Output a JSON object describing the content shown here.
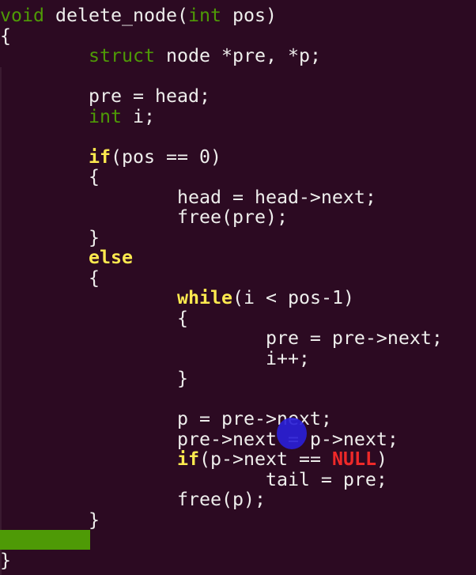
{
  "editor": {
    "colors": {
      "background": "#2c0a22",
      "text": "#eeeeec",
      "type": "#4e9a06",
      "keyword": "#fce94f",
      "constant": "#ef2929",
      "highlight_bar": "#4e9a06",
      "pointer": "#2a1fd6"
    },
    "lines": [
      [
        [
          "void",
          "type"
        ],
        [
          " delete_node(",
          "plain"
        ],
        [
          "int",
          "type"
        ],
        [
          " pos)",
          "plain"
        ]
      ],
      [
        [
          "{",
          "plain"
        ]
      ],
      [
        [
          "        ",
          "plain"
        ],
        [
          "struct",
          "type"
        ],
        [
          " node *pre, *p;",
          "plain"
        ]
      ],
      [],
      [
        [
          "        pre = head;",
          "plain"
        ]
      ],
      [
        [
          "        ",
          "plain"
        ],
        [
          "int",
          "type"
        ],
        [
          " i;",
          "plain"
        ]
      ],
      [],
      [
        [
          "        ",
          "plain"
        ],
        [
          "if",
          "kw"
        ],
        [
          "(pos == 0)",
          "plain"
        ]
      ],
      [
        [
          "        {",
          "plain"
        ]
      ],
      [
        [
          "                head = head->next;",
          "plain"
        ]
      ],
      [
        [
          "                free(pre);",
          "plain"
        ]
      ],
      [
        [
          "        }",
          "plain"
        ]
      ],
      [
        [
          "        ",
          "plain"
        ],
        [
          "else",
          "kw"
        ]
      ],
      [
        [
          "        {",
          "plain"
        ]
      ],
      [
        [
          "                ",
          "plain"
        ],
        [
          "while",
          "kw"
        ],
        [
          "(i < pos-1)",
          "plain"
        ]
      ],
      [
        [
          "                {",
          "plain"
        ]
      ],
      [
        [
          "                        pre = pre->next;",
          "plain"
        ]
      ],
      [
        [
          "                        i++;",
          "plain"
        ]
      ],
      [
        [
          "                }",
          "plain"
        ]
      ],
      [],
      [
        [
          "                p = pre->next;",
          "plain"
        ]
      ],
      [
        [
          "                pre->next = p->next;",
          "plain"
        ]
      ],
      [
        [
          "                ",
          "plain"
        ],
        [
          "if",
          "kw"
        ],
        [
          "(p->next == ",
          "plain"
        ],
        [
          "NULL",
          "const"
        ],
        [
          ")",
          "plain"
        ]
      ],
      [
        [
          "                        tail = pre;",
          "plain"
        ]
      ],
      [
        [
          "                free(p);",
          "plain"
        ]
      ],
      [
        [
          "        }",
          "plain"
        ]
      ],
      [],
      [
        [
          "}",
          "plain"
        ]
      ]
    ]
  }
}
